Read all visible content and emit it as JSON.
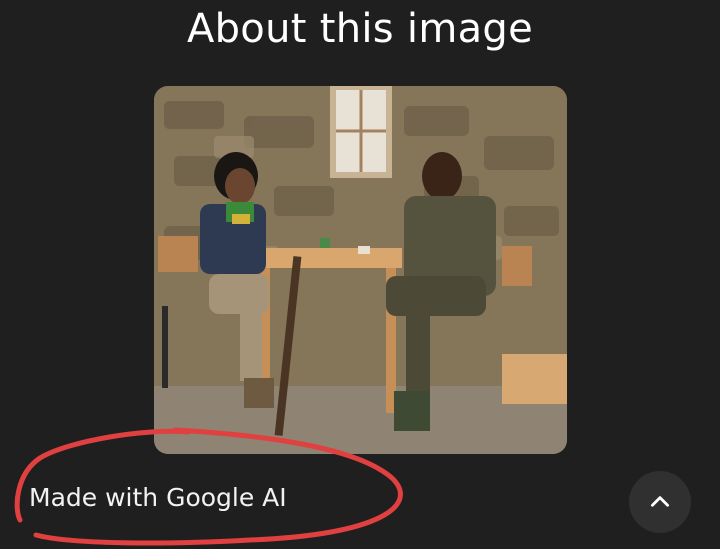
{
  "header": {
    "title": "About this image"
  },
  "image": {
    "alt": "Photo of two men sitting at a wooden table in a stone-walled room"
  },
  "footer": {
    "caption": "Made with Google AI"
  },
  "icons": {
    "scroll_up": "chevron-up-icon"
  },
  "colors": {
    "background": "#1f1f1f",
    "annotation": "#e0403f",
    "button": "#303030"
  }
}
